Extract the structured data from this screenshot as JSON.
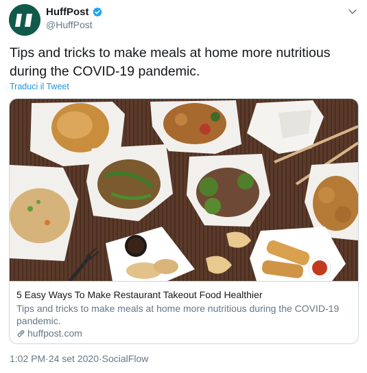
{
  "author": {
    "display_name": "HuffPost",
    "handle": "@HuffPost",
    "avatar_icon": "huffpost-logo",
    "verified_icon": "verified-badge-icon",
    "brand_color": "#0f5a4a"
  },
  "tweet": {
    "text": "Tips and tricks to make meals at home more nutritious during the COVID-19 pandemic.",
    "translate_label": "Traduci il Tweet"
  },
  "card": {
    "image_icon": "takeout-food-photo",
    "title": "5 Easy Ways To Make Restaurant Takeout Food Healthier",
    "description": "Tips and tricks to make meals at home more nutritious during the COVID-19 pandemic.",
    "link_icon": "link-icon",
    "domain": "huffpost.com"
  },
  "meta": {
    "time": "1:02 PM",
    "separator": " · ",
    "date": "24 set 2020",
    "source": "SocialFlow"
  },
  "colors": {
    "link": "#1b95e0",
    "secondary_text": "#657786",
    "border": "#ccd6dd"
  }
}
